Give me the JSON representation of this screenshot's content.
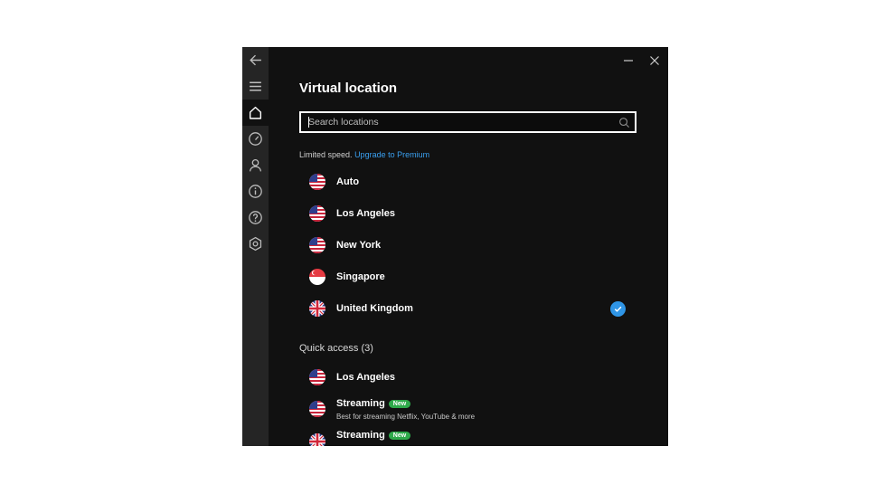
{
  "nav": {
    "items": [
      {
        "icon": "back-arrow-icon"
      },
      {
        "icon": "menu-icon"
      },
      {
        "icon": "home-icon",
        "active": true
      },
      {
        "icon": "speedometer-icon"
      },
      {
        "icon": "account-icon"
      },
      {
        "icon": "info-icon"
      },
      {
        "icon": "help-icon"
      },
      {
        "icon": "settings-icon"
      }
    ]
  },
  "window_controls": {
    "minimize": "minimize-icon",
    "close": "close-icon"
  },
  "header": {
    "title": "Virtual location"
  },
  "search": {
    "placeholder": "Search locations",
    "value": ""
  },
  "notice": {
    "text": "Limited speed.",
    "link": "Upgrade to Premium"
  },
  "locations": [
    {
      "label": "Auto",
      "flag": "us-flag-icon",
      "selected": false
    },
    {
      "label": "Los Angeles",
      "flag": "us-flag-icon",
      "selected": false
    },
    {
      "label": "New York",
      "flag": "us-flag-icon",
      "selected": false
    },
    {
      "label": "Singapore",
      "flag": "singapore-flag-icon",
      "selected": false
    },
    {
      "label": "United Kingdom",
      "flag": "uk-flag-icon",
      "selected": true
    }
  ],
  "quick_access": {
    "title": "Quick access (3)",
    "items": [
      {
        "label": "Los Angeles",
        "flag": "us-flag-icon",
        "badge": "",
        "subtitle": ""
      },
      {
        "label": "Streaming",
        "flag": "us-flag-icon",
        "badge": "New",
        "subtitle": "Best for streaming Netflix, YouTube & more"
      },
      {
        "label": "Streaming",
        "flag": "uk-flag-icon",
        "badge": "New",
        "subtitle": ""
      }
    ]
  },
  "colors": {
    "background": "#111111",
    "rail": "#252525",
    "accent": "#2f95e6",
    "link": "#3aa0f0",
    "badge": "#2ea94a"
  }
}
